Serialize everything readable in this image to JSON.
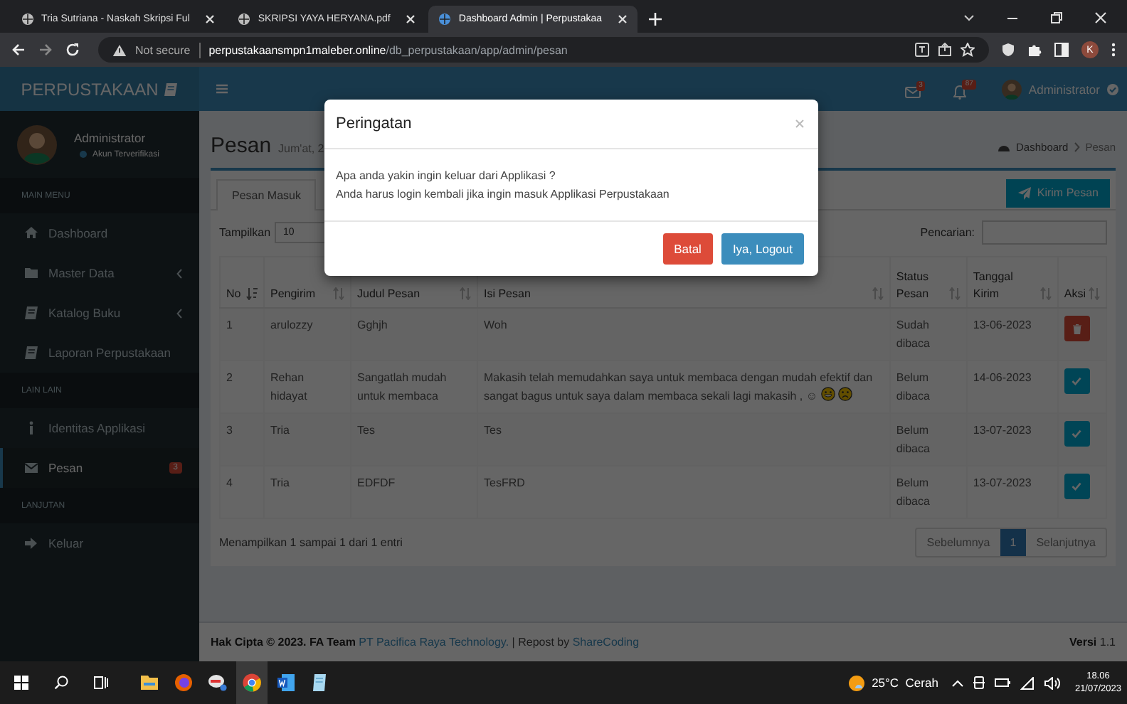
{
  "browser": {
    "tabs": [
      {
        "title": "Tria Sutriana - Naskah Skripsi Ful",
        "selected": false
      },
      {
        "title": "SKRIPSI YAYA HERYANA.pdf",
        "selected": false
      },
      {
        "title": "Dashboard Admin | Perpustakaa",
        "selected": true
      }
    ],
    "security": "Not secure",
    "url_host": "perpustakaansmpn1maleber.online",
    "url_path": "/db_perpustakaan/app/admin/pesan",
    "profile": "K"
  },
  "navbar": {
    "brand": "PERPUSTAKAAN",
    "messages_badge": "3",
    "notifications_badge": "87",
    "user": "Administrator"
  },
  "sidebar": {
    "user_name": "Administrator",
    "user_status": "Akun Terverifikasi",
    "sections": [
      {
        "header": "MAIN MENU",
        "items": [
          {
            "label": "Dashboard",
            "kind": "home",
            "submenu": false,
            "selected": false
          },
          {
            "label": "Master Data",
            "kind": "folder",
            "submenu": true,
            "selected": false
          },
          {
            "label": "Katalog Buku",
            "kind": "book",
            "submenu": true,
            "selected": false
          },
          {
            "label": "Laporan Perpustakaan",
            "kind": "book",
            "submenu": false,
            "selected": false
          }
        ]
      },
      {
        "header": "LAIN LAIN",
        "items": [
          {
            "label": "Identitas Applikasi",
            "kind": "info",
            "submenu": false,
            "selected": false
          },
          {
            "label": "Pesan",
            "kind": "mail",
            "submenu": false,
            "selected": true,
            "badge": "3"
          }
        ]
      },
      {
        "header": "LANJUTAN",
        "items": [
          {
            "label": "Keluar",
            "kind": "logout",
            "submenu": false,
            "selected": false
          }
        ]
      }
    ]
  },
  "page": {
    "title": "Pesan",
    "subtitle": "Jum'at, 2",
    "breadcrumb": [
      "Dashboard",
      "Pesan"
    ]
  },
  "box": {
    "tabs": [
      {
        "label": "Pesan Masuk",
        "selected": true
      }
    ],
    "send_button": "Kirim Pesan",
    "length_label": "Tampilkan",
    "length_value": "10",
    "search_label": "Pencarian:"
  },
  "table": {
    "columns": [
      {
        "label": "No",
        "kind": "sorted"
      },
      {
        "label": "Pengirim",
        "kind": "sortable"
      },
      {
        "label": "Judul Pesan",
        "kind": "sortable"
      },
      {
        "label": "Isi Pesan",
        "kind": "sortable"
      },
      {
        "label": "Status Pesan",
        "kind": "sortable"
      },
      {
        "label": "Tanggal Kirim",
        "kind": "sortable"
      },
      {
        "label": "Aksi",
        "kind": "sortable"
      }
    ],
    "rows": [
      {
        "cells": [
          "1",
          "arulozzy",
          "Gghjh",
          "Woh",
          "Sudah dibaca",
          "13-06-2023"
        ],
        "kind": "delete"
      },
      {
        "cells": [
          "2",
          "Rehan hidayat",
          "Sangatlah mudah untuk membaca",
          "Makasih telah memudahkan saya untuk membaca dengan mudah efektif dan sangat bagus untuk saya dalam membaca sekali lagi makasih , ☺",
          "Belum dibaca",
          "14-06-2023"
        ],
        "kind": "read",
        "emojis": [
          {
            "kind": "grin"
          },
          {
            "kind": "sad"
          }
        ]
      },
      {
        "cells": [
          "3",
          "Tria",
          "Tes",
          "Tes",
          "Belum dibaca",
          "13-07-2023"
        ],
        "kind": "read"
      },
      {
        "cells": [
          "4",
          "Tria",
          "EDFDF",
          "TesFRD",
          "Belum dibaca",
          "13-07-2023"
        ],
        "kind": "read"
      }
    ]
  },
  "info": "Menampilkan 1 sampai 1 dari 1 entri",
  "pagination": [
    {
      "label": "Sebelumnya",
      "selected": false
    },
    {
      "label": "1",
      "selected": true
    },
    {
      "label": "Selanjutnya",
      "selected": false
    }
  ],
  "footer": {
    "copyright": "Hak Cipta © 2023. FA Team",
    "company": "PT Pacifica Raya Technology.",
    "repost": "| Repost by",
    "credit": "ShareCoding",
    "version_label": "Versi",
    "version": "1.1"
  },
  "modal": {
    "title": "Peringatan",
    "lines": [
      "Apa anda yakin ingin keluar dari Applikasi ?",
      "Anda harus login kembali jika ingin masuk Applikasi Perpustakaan"
    ],
    "buttons": [
      {
        "label": "Batal",
        "kind": "danger"
      },
      {
        "label": "Iya, Logout",
        "kind": "primary"
      }
    ]
  },
  "taskbar": {
    "apps": [
      {
        "kind": "files",
        "active": false
      },
      {
        "kind": "firefox",
        "active": false
      },
      {
        "kind": "tool",
        "active": false
      },
      {
        "kind": "chrome",
        "active": true
      },
      {
        "kind": "word",
        "active": false
      },
      {
        "kind": "notes",
        "active": false
      }
    ],
    "weather": "25°C  Cerah",
    "time": "18.06",
    "date": "21/07/2023"
  }
}
